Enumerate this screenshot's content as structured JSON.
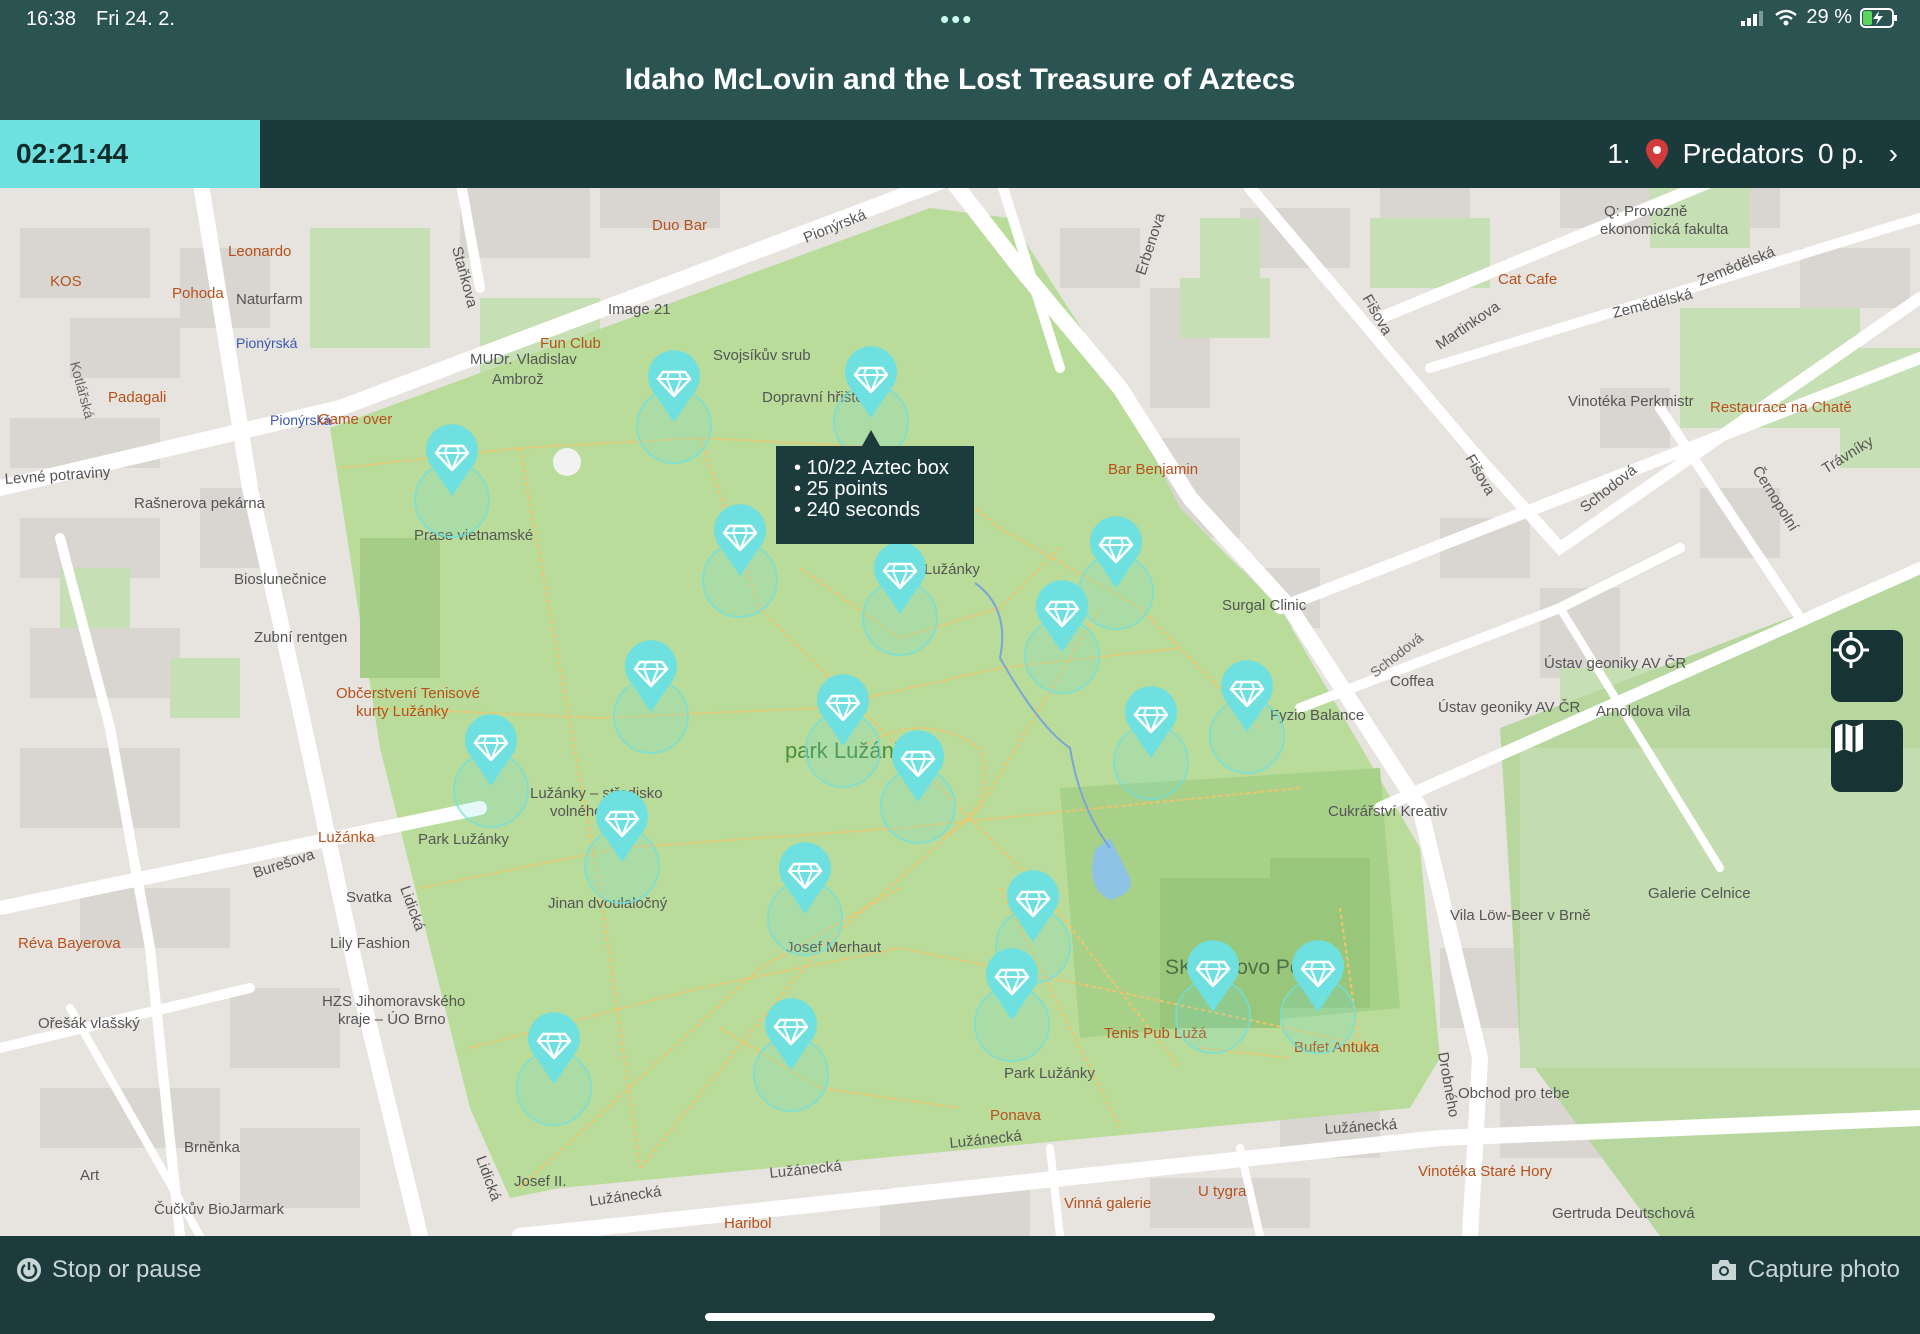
{
  "status": {
    "time": "16:38",
    "date": "Fri 24. 2.",
    "battery": "29 %"
  },
  "app": {
    "title": "Idaho McLovin and the Lost Treasure of Aztecs"
  },
  "game": {
    "timer": "02:21:44",
    "rank": "1.",
    "team_name": "Predators",
    "team_points": "0 p."
  },
  "tooltip": {
    "line1": "10/22 Aztec box",
    "line2": "25 points",
    "line3": "240 seconds"
  },
  "map_labels": {
    "park": "park Lužánky",
    "sk": "SK Královo Pole",
    "pionyrska": "Pionýrská",
    "pionyrska2": "Pionýrská",
    "pionyrska3": "Pionýrská",
    "lidicka": "Lidická",
    "lidicka2": "Lidická",
    "luzanecka": "Lužánecká",
    "luzanecka2": "Lužánecká",
    "luzanecka3": "Lužánecká",
    "luzanecka4": "Lužánecká",
    "buresova": "Burešova",
    "drobneho": "Drobného",
    "stankova": "Staňkova",
    "erbenova": "Erbenova",
    "fisova": "Fišova",
    "fisova2": "Fišova",
    "martinkova": "Martinkova",
    "zemedelska": "Zemědělská",
    "zemedelska2": "Zemědělská",
    "schodova": "Schodová",
    "schodova2": "Schodová",
    "cernopolni": "Černopolní",
    "travniky": "Trávníky",
    "kotlarska": "Kotlářská",
    "duo_bar": "Duo Bar",
    "image21": "Image 21",
    "fun_club": "Fun Club",
    "mudr": "MUDr. Vladislav",
    "ambroz": "Ambrož",
    "svojsikuv": "Svojsíkův srub",
    "dopravni": "Dopravní hřiště",
    "leonardo": "Leonardo",
    "kos": "KOS",
    "pohoda": "Pohoda",
    "naturfarm": "Naturfarm",
    "padagali": "Padagali",
    "game_over": "Game over",
    "levne": "Levné potraviny",
    "rasnerova": "Rašnerova pekárna",
    "biosl": "Bioslunečnice",
    "zubni": "Zubní rentgen",
    "praso": "Prase vietnamské",
    "obcerstveni": "Občerstvení Tenisové",
    "kurty": "kurty Lužánky",
    "luzanky_str": "Lužánky – středisko",
    "volneho": "volného času",
    "park_luzanky_l": "Park Lužánky",
    "luzanka": "Lužánka",
    "jinan": "Jinan dvoulaločný",
    "svatka": "Svatka",
    "lily": "Lily Fashion",
    "hzs": "HZS Jihomoravského",
    "hzs2": "kraje – ÚO Brno",
    "reva": "Réva Bayerova",
    "oresak": "Ořešák vlašský",
    "brnenka": "Brněnka",
    "art": "Art",
    "cuckuv": "Čučkův BioJarmark",
    "josef2": "Josef II.",
    "haribol": "Haribol",
    "josef_m": "Josef Merhaut",
    "ponava": "Ponava",
    "park_luzanky_b": "Park Lužánky",
    "tenis_pub": "Tenis Pub Lužá",
    "bufet": "Bufet Antuka",
    "vinna": "Vinná galerie",
    "u_tygra": "U tygra",
    "obchod": "Obchod pro tebe",
    "vinoteka_sh": "Vinotéka Staré Hory",
    "gertruda": "Gertruda Deutschová",
    "vila_low": "Vila Löw-Beer v Brně",
    "galerie": "Galerie Celnice",
    "cukrarstvi": "Cukrářství Kreativ",
    "fyzio": "Fyzio Balance",
    "coffea": "Coffea",
    "ustav1": "Ústav geoniky AV ČR",
    "ustav2": "Ústav geoniky AV ČR",
    "arnoldova": "Arnoldova vila",
    "surgal": "Surgal Clinic",
    "bar_benjamin": "Bar Benjamin",
    "cat_cafe": "Cat Cafe",
    "vinoteka_p": "Vinotéka Perkmistr",
    "restaurace": "Restaurace na Chatě",
    "provozne": "Q: Provozně",
    "ekonomicka": "ekonomická fakulta",
    "ruzanky": "Lužánky",
    "buchta": "Pub"
  },
  "bottom": {
    "stop_label": "Stop or pause",
    "capture_label": "Capture photo"
  },
  "colors": {
    "accent": "#6fe0e0",
    "header": "#2a5352",
    "dark": "#1b3a3c",
    "park": "#b9dc9a",
    "marker_red": "#d33a3a"
  }
}
